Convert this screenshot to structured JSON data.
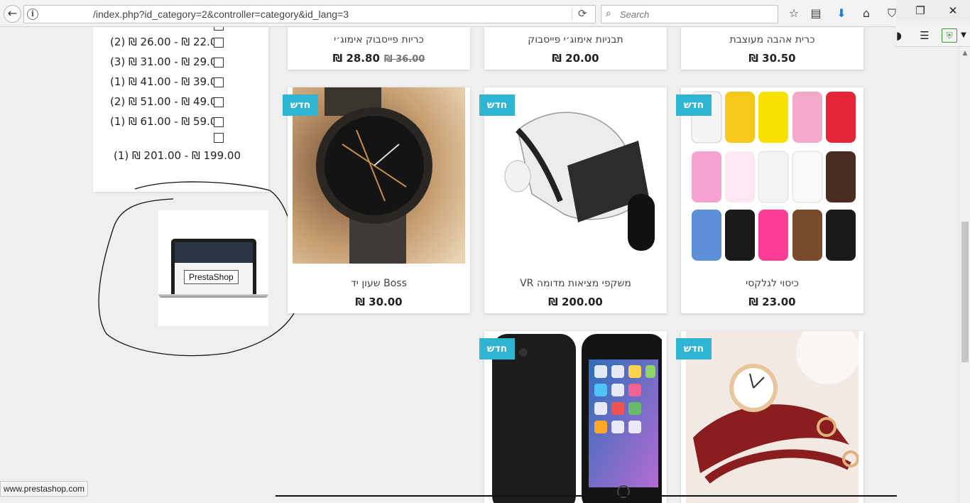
{
  "browser": {
    "url": "/index.php?id_category=2&controller=category&id_lang=3",
    "search_placeholder": "Search",
    "status_url": "www.prestashop.com"
  },
  "filter": {
    "price_rows": [
      {
        "text": "(2) ₪ 26.00 - ₪ 22.00"
      },
      {
        "text": "(3) ₪ 31.00 - ₪ 29.00"
      },
      {
        "text": "(1) ₪ 41.00 - ₪ 39.00"
      },
      {
        "text": "(2) ₪ 51.00 - ₪ 49.00"
      },
      {
        "text": "(1) ₪ 61.00 - ₪ 59.00"
      }
    ],
    "last_row": "(1) ₪ 201.00 - ₪ 199.00"
  },
  "ad": {
    "tooltip": "PrestaShop"
  },
  "badge_label": "חדש",
  "products_top": [
    {
      "title": "כריות פייסבוק אימוג׳י",
      "price": "₪ 28.80",
      "old_price": "₪ 36.00"
    },
    {
      "title": "תבניות אימוג׳י פייסבוק",
      "price": "₪ 20.00"
    },
    {
      "title": "כרית אהבה מעוצבת",
      "price": "₪ 30.50"
    }
  ],
  "products_mid": [
    {
      "title": "שעון יד Boss",
      "price": "₪ 30.00"
    },
    {
      "title": "VR משקפי מציאות מדומה",
      "price": "₪ 200.00"
    },
    {
      "title": "כיסוי לגלקסי",
      "price": "₪ 23.00"
    }
  ],
  "colors": {
    "badge": "#2fb5d2"
  }
}
